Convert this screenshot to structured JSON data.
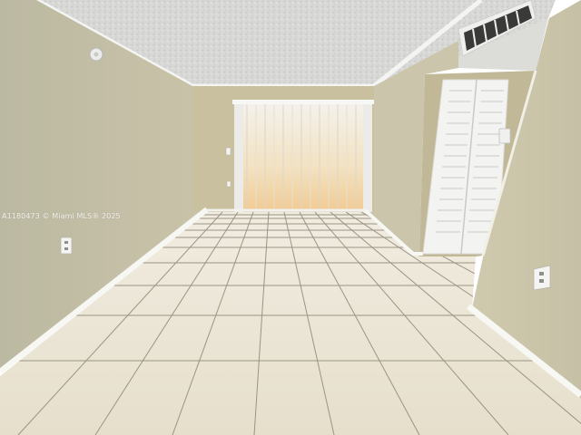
{
  "photo": {
    "watermark": "A1180473 © Miami MLS® 2025"
  },
  "colors": {
    "ceiling": "#d9d9d7",
    "wall_left": "#c3bfa7",
    "wall_back": "#c9c1a1",
    "wall_right": "#c9c4aa",
    "floor_tile": "#ebe4d1",
    "grout": "#8f8a7d",
    "baseboard": "#f5f5f2",
    "curtain": "#f2f2f0",
    "window_glow": "#f3c27a"
  }
}
